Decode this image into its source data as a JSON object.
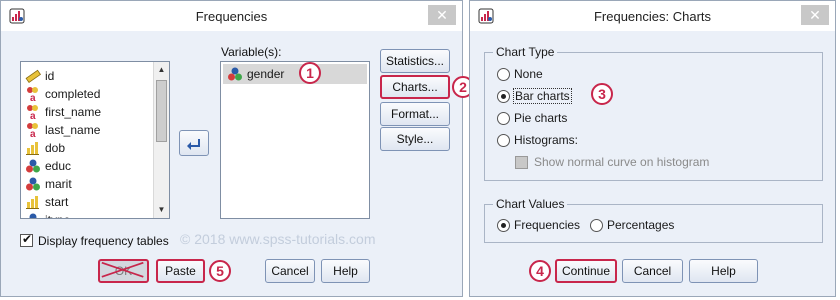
{
  "left_dialog": {
    "title": "Frequencies",
    "close_glyph": "✕",
    "source_variables": [
      {
        "name": "id",
        "icon": "ruler-icon"
      },
      {
        "name": "completed",
        "icon": "nominal-string-icon"
      },
      {
        "name": "first_name",
        "icon": "nominal-string-icon"
      },
      {
        "name": "last_name",
        "icon": "nominal-string-icon"
      },
      {
        "name": "dob",
        "icon": "ordinal-icon"
      },
      {
        "name": "educ",
        "icon": "nominal-icon"
      },
      {
        "name": "marit",
        "icon": "nominal-icon"
      },
      {
        "name": "start",
        "icon": "ordinal-icon"
      },
      {
        "name": "jtype",
        "icon": "nominal-icon"
      }
    ],
    "variables_label": "Variable(s):",
    "selected_variables": [
      {
        "name": "gender",
        "icon": "nominal-icon"
      }
    ],
    "badge_1": "1",
    "buttons": {
      "statistics": "Statistics...",
      "charts": "Charts...",
      "format": "Format...",
      "style": "Style..."
    },
    "badge_2": "2",
    "display_tables_label": "Display frequency tables",
    "display_tables_checked": true,
    "bottom_buttons": {
      "ok": "OK",
      "paste": "Paste",
      "cancel": "Cancel",
      "help": "Help"
    },
    "badge_5": "5"
  },
  "watermark": "© 2018 www.spss-tutorials.com",
  "right_dialog": {
    "title": "Frequencies: Charts",
    "close_glyph": "✕",
    "chart_type_title": "Chart Type",
    "chart_type_options": [
      {
        "label": "None",
        "selected": false
      },
      {
        "label": "Bar charts",
        "selected": true
      },
      {
        "label": "Pie charts",
        "selected": false
      },
      {
        "label": "Histograms:",
        "selected": false
      }
    ],
    "badge_3": "3",
    "show_normal_curve_label": "Show normal curve on histogram",
    "show_normal_curve_enabled": false,
    "chart_values_title": "Chart Values",
    "chart_values_options": [
      {
        "label": "Frequencies",
        "selected": true
      },
      {
        "label": "Percentages",
        "selected": false
      }
    ],
    "badge_4": "4",
    "buttons": {
      "continue": "Continue",
      "cancel": "Cancel",
      "help": "Help"
    }
  },
  "colors": {
    "dialog_bg": "#ebf0f8",
    "highlight": "#c8264b",
    "button_border": "#7e93b5"
  }
}
